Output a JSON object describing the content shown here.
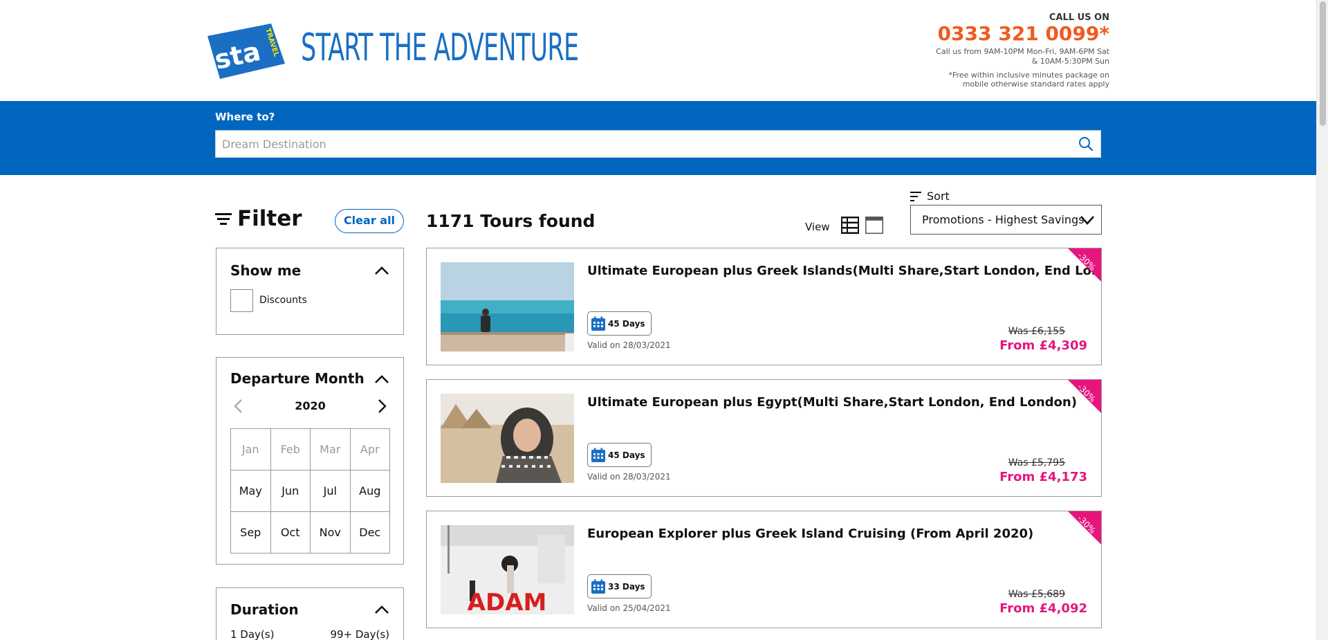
{
  "header": {
    "logo_text": "sta",
    "logo_sub": "TRAVEL",
    "tagline": "START THE ADVENTURE",
    "call_label": "CALL US ON",
    "phone": "0333 321 0099*",
    "hours_line1": "Call us from 9AM-10PM Mon-Fri, 9AM-6PM Sat",
    "hours_line2": "& 10AM-5:30PM Sun",
    "note_line1": "*Free within inclusive minutes package on",
    "note_line2": "mobile otherwise standard rates apply"
  },
  "search": {
    "label": "Where to?",
    "placeholder": "Dream Destination"
  },
  "filter": {
    "title": "Filter",
    "clear_label": "Clear all",
    "show_me": {
      "title": "Show me",
      "option": "Discounts"
    },
    "departure": {
      "title": "Departure Month",
      "year": "2020",
      "months": [
        "Jan",
        "Feb",
        "Mar",
        "Apr",
        "May",
        "Jun",
        "Jul",
        "Aug",
        "Sep",
        "Oct",
        "Nov",
        "Dec"
      ]
    },
    "duration": {
      "title": "Duration",
      "min": "1 Day(s)",
      "max": "99+ Day(s)"
    }
  },
  "results": {
    "count_text": "1171 Tours found",
    "view_label": "View",
    "sort_label": "Sort",
    "sort_value": "Promotions - Highest Savings"
  },
  "tours": [
    {
      "title": "Ultimate European plus Greek Islands(Multi Share,Start London, End London)",
      "days": "45 Days",
      "valid": "Valid on 28/03/2021",
      "was": "Was £6,155",
      "price": "From £4,309",
      "discount": "-30%"
    },
    {
      "title": "Ultimate European plus Egypt(Multi Share,Start London, End London)",
      "days": "45 Days",
      "valid": "Valid on 28/03/2021",
      "was": "Was £5,795",
      "price": "From £4,173",
      "discount": "-30%"
    },
    {
      "title": "European Explorer plus Greek Island Cruising (From April 2020)",
      "days": "33 Days",
      "valid": "Valid on 25/04/2021",
      "was": "Was £5,689",
      "price": "From £4,092",
      "discount": "-30%",
      "photo_text": "ADAM"
    }
  ],
  "colors": {
    "brand_blue": "#0066c0",
    "phone_orange": "#f05a1e",
    "price_pink": "#e6157e"
  }
}
